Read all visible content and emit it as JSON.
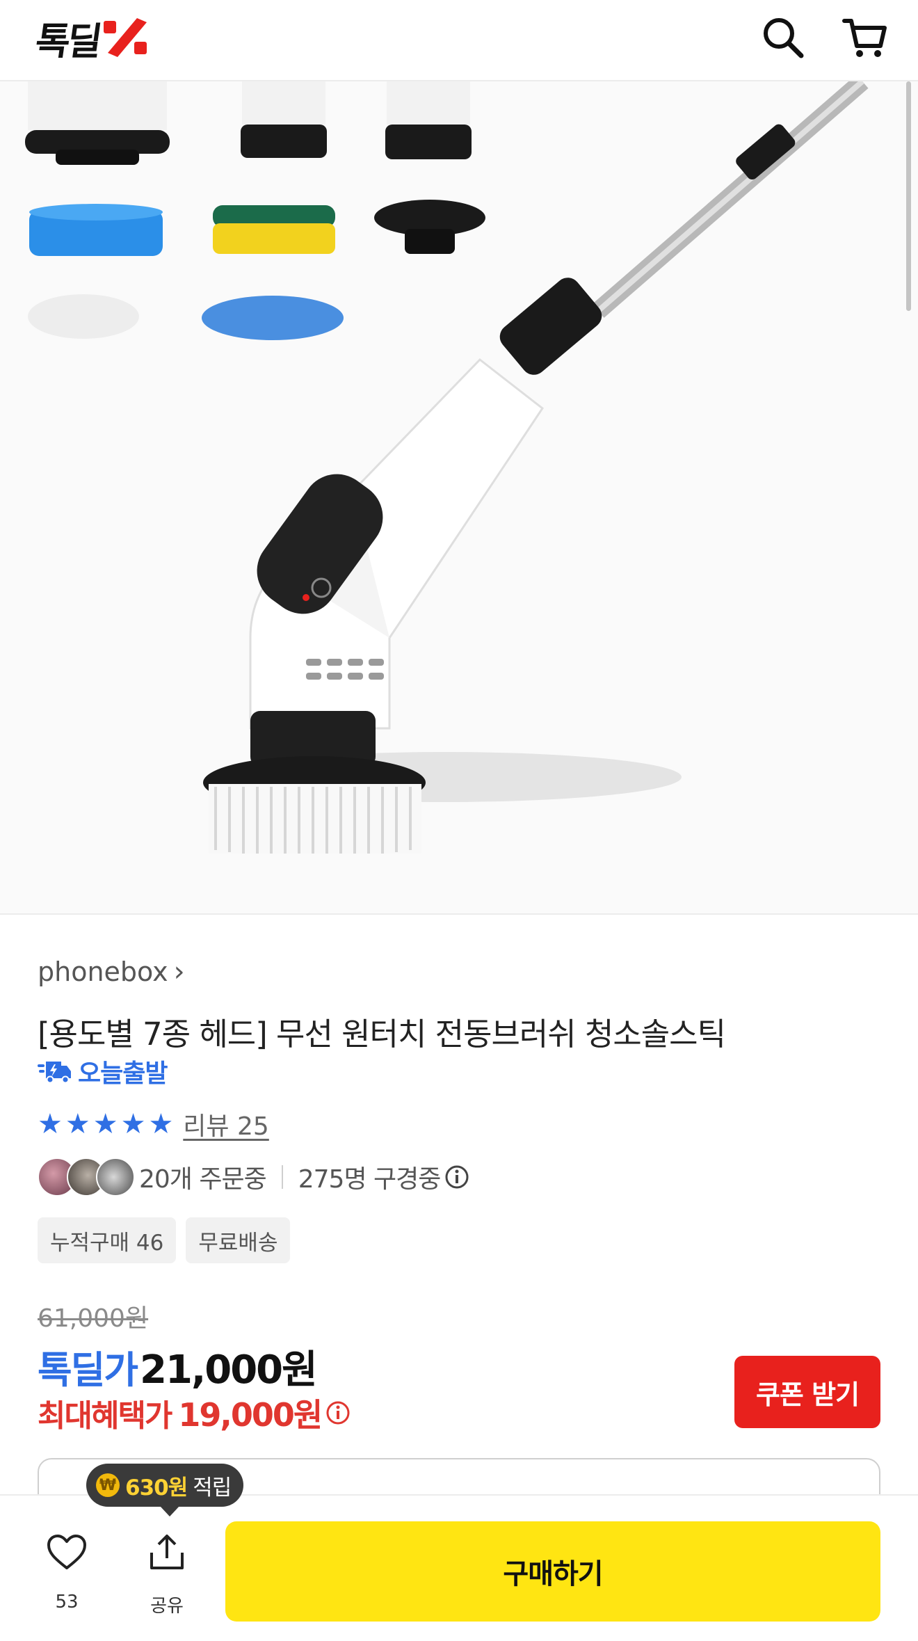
{
  "header": {
    "logo_text": "톡딜",
    "logo_mark": "%",
    "icons": [
      "search-icon",
      "cart-icon"
    ]
  },
  "product": {
    "seller": "phonebox",
    "seller_chevron": "›",
    "title": "[용도별 7종 헤드] 무선 원터치 전동브러쉬 청소솔스틱",
    "delivery_badge": "오늘출발",
    "rating_stars": 5,
    "review_label": "리뷰 25",
    "orders_text": "20개 주문중",
    "viewers_text": "275명 구경중",
    "badges": [
      "누적구매 46",
      "무료배송"
    ],
    "original_price": "61,000원",
    "deal_label": "톡딜가",
    "deal_price": "21,000원",
    "max_benefit_label": "최대혜택가",
    "max_benefit_price": "19,000원",
    "coupon_button": "쿠폰 받기"
  },
  "tooltip": {
    "coin_symbol": "₩",
    "amount": "630원",
    "text": "적립"
  },
  "bottom_bar": {
    "like_count": "53",
    "share_label": "공유",
    "buy_button": "구매하기"
  },
  "colors": {
    "accent_blue": "#2f6fe4",
    "accent_red": "#e0362f",
    "coupon_red": "#e8211d",
    "buy_yellow": "#ffe512",
    "logo_red": "#e8211d"
  }
}
